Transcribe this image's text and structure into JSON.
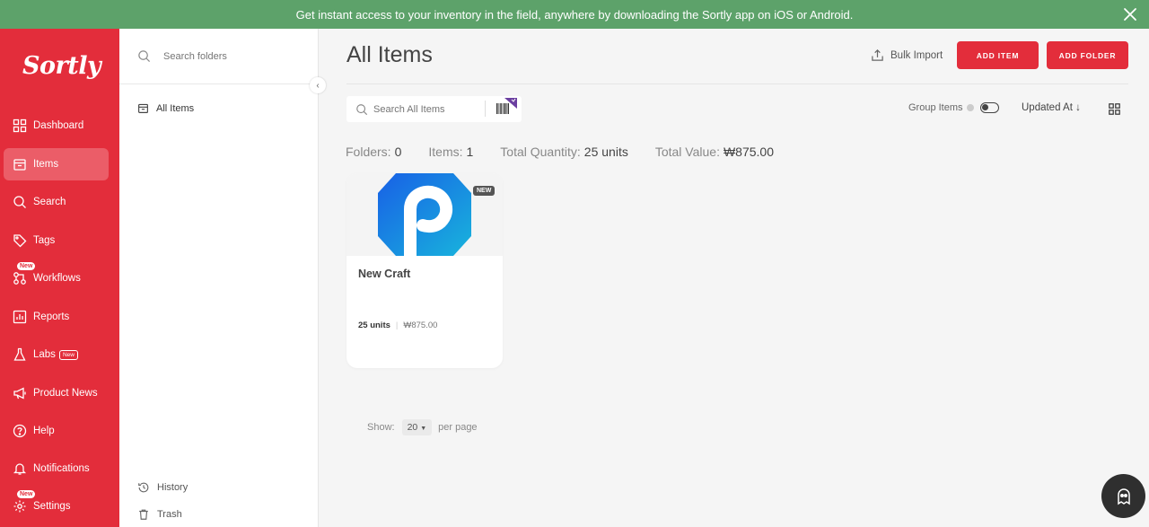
{
  "banner": {
    "text": "Get instant access to your inventory in the field, anywhere by downloading the Sortly app on iOS or Android."
  },
  "logo": "Sortly",
  "nav": {
    "dashboard": "Dashboard",
    "items": "Items",
    "search": "Search",
    "tags": "Tags",
    "workflows": "Workflows",
    "reports": "Reports",
    "labs": "Labs",
    "product_news": "Product News",
    "help": "Help",
    "notifications": "Notifications",
    "settings": "Settings",
    "new_badge": "New",
    "labs_badge": "New"
  },
  "folders": {
    "search_placeholder": "Search folders",
    "all_items": "All Items",
    "history": "History",
    "trash": "Trash"
  },
  "main": {
    "title": "All Items",
    "bulk_import": "Bulk Import",
    "add_item": "ADD ITEM",
    "add_folder": "ADD FOLDER",
    "search_placeholder": "Search All Items",
    "group_items": "Group Items",
    "sort_label": "Updated At",
    "sort_arrow": "↓"
  },
  "summary": {
    "folders_label": "Folders:",
    "folders_value": "0",
    "items_label": "Items:",
    "items_value": "1",
    "quantity_label": "Total Quantity:",
    "quantity_value": "25 units",
    "value_label": "Total Value:",
    "value_value": "₩875.00"
  },
  "items": [
    {
      "name": "New Craft",
      "badge": "NEW",
      "quantity": "25 units",
      "value": "₩875.00"
    }
  ],
  "pagination": {
    "show_label": "Show:",
    "page_size": "20",
    "per_page_label": "per page"
  },
  "colors": {
    "brand": "#e32d3b",
    "banner": "#5da26a",
    "thumb_blue": "#1f7ae0"
  }
}
